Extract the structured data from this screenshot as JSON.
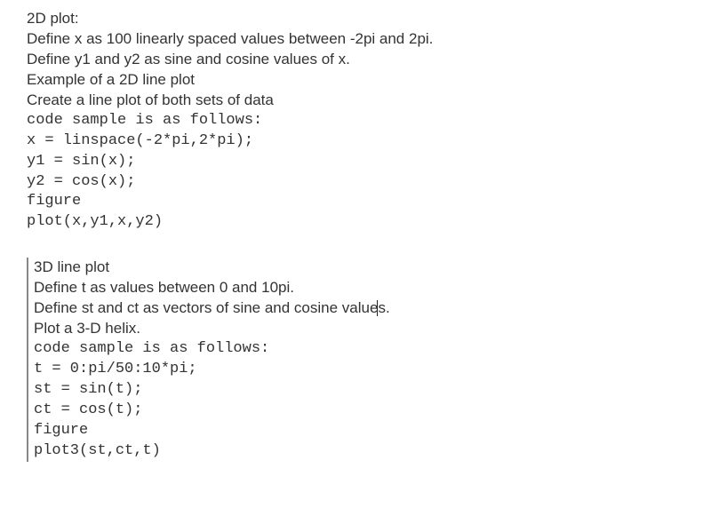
{
  "section1": {
    "header": "2D plot:",
    "desc1": "Define x as 100 linearly spaced values between -2pi and 2pi.",
    "desc2": "Define y1 and y2 as sine and cosine values of x.",
    "desc3": "Example of a 2D line plot",
    "desc4": "Create a line plot of both sets of data",
    "sample_intro": "code sample is as follows:",
    "code": {
      "l1": "x = linspace(-2*pi,2*pi);",
      "l2": "y1 = sin(x);",
      "l3": "y2 = cos(x);",
      "l4": "figure",
      "l5": "plot(x,y1,x,y2)"
    }
  },
  "section2": {
    "header": "3D line plot",
    "desc1": "Define t as values between 0 and 10pi.",
    "desc2_a": "Define st and ct as vectors of sine and cosine value",
    "desc2_b": "s.",
    "desc3": "Plot a 3-D helix.",
    "sample_intro": "code sample is as follows:",
    "code": {
      "l1": "t = 0:pi/50:10*pi;",
      "l2": "st = sin(t);",
      "l3": "ct = cos(t);",
      "l4": "figure",
      "l5": "plot3(st,ct,t)"
    }
  }
}
